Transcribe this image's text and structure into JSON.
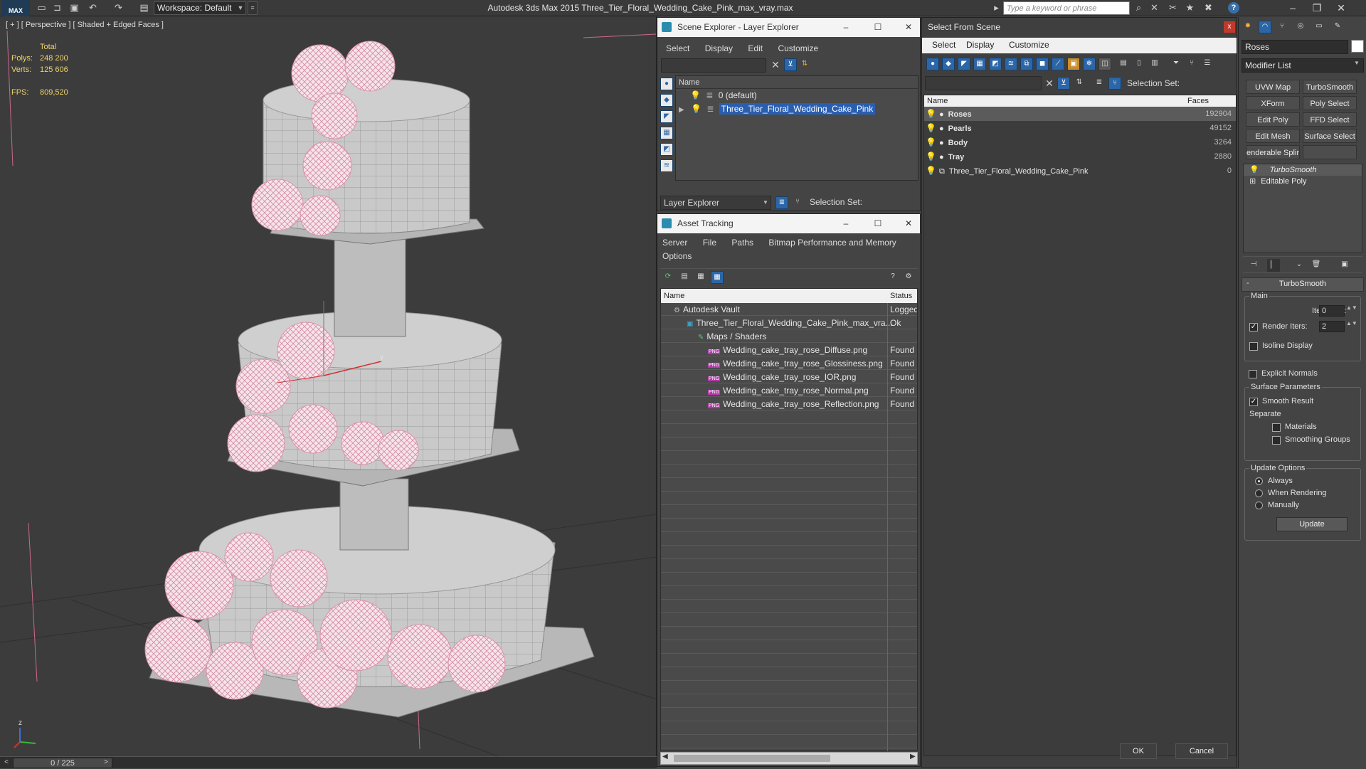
{
  "titlebar": {
    "logo": "MAX",
    "workspace": "Workspace: Default",
    "title": "Autodesk 3ds Max  2015     Three_Tier_Floral_Wedding_Cake_Pink_max_vray.max",
    "search_placeholder": "Type a keyword or phrase"
  },
  "viewport": {
    "label": "[ + ] [ Perspective ] [ Shaded + Edged Faces ]",
    "stats": {
      "total_label": "Total",
      "polys_label": "Polys:",
      "polys_value": "248 200",
      "verts_label": "Verts:",
      "verts_value": "125 606",
      "fps_label": "FPS:",
      "fps_value": "809,520"
    },
    "axis": {
      "x": "x",
      "y": "y",
      "z": "z"
    }
  },
  "timeline": {
    "counter": "0 / 225",
    "prev": "<",
    "next": ">"
  },
  "scene_explorer": {
    "title": "Scene Explorer - Layer Explorer",
    "menu": [
      "Select",
      "Display",
      "Edit",
      "Customize"
    ],
    "col_name": "Name",
    "layers": [
      {
        "name": "0 (default)",
        "selected": false
      },
      {
        "name": "Three_Tier_Floral_Wedding_Cake_Pink",
        "selected": true
      }
    ],
    "footer_dropdown": "Layer Explorer",
    "selection_set_label": "Selection Set:"
  },
  "asset_tracking": {
    "title": "Asset Tracking",
    "menu": [
      "Server",
      "File",
      "Paths",
      "Bitmap Performance and Memory"
    ],
    "menu2": [
      "Options"
    ],
    "col_name": "Name",
    "col_status": "Status",
    "rows": [
      {
        "name": "Autodesk Vault",
        "status": "Logged",
        "indent": 1
      },
      {
        "name": "Three_Tier_Floral_Wedding_Cake_Pink_max_vra...",
        "status": "Ok",
        "indent": 2
      },
      {
        "name": "Maps / Shaders",
        "status": "",
        "indent": 3
      },
      {
        "name": "Wedding_cake_tray_rose_Diffuse.png",
        "status": "Found",
        "indent": 4
      },
      {
        "name": "Wedding_cake_tray_rose_Glossiness.png",
        "status": "Found",
        "indent": 4
      },
      {
        "name": "Wedding_cake_tray_rose_IOR.png",
        "status": "Found",
        "indent": 4
      },
      {
        "name": "Wedding_cake_tray_rose_Normal.png",
        "status": "Found",
        "indent": 4
      },
      {
        "name": "Wedding_cake_tray_rose_Reflection.png",
        "status": "Found",
        "indent": 4
      }
    ]
  },
  "select_from_scene": {
    "title": "Select From Scene",
    "close": "x",
    "menu": [
      "Select",
      "Display",
      "Customize"
    ],
    "selection_set_label": "Selection Set:",
    "col_name": "Name",
    "col_faces": "Faces",
    "objects": [
      {
        "name": "Roses",
        "faces": "192904",
        "selected": true,
        "bold": true
      },
      {
        "name": "Pearls",
        "faces": "49152",
        "selected": false,
        "bold": true
      },
      {
        "name": "Body",
        "faces": "3264",
        "selected": false,
        "bold": true
      },
      {
        "name": "Tray",
        "faces": "2880",
        "selected": false,
        "bold": true
      },
      {
        "name": "Three_Tier_Floral_Wedding_Cake_Pink",
        "faces": "0",
        "selected": false,
        "bold": false
      }
    ],
    "ok": "OK",
    "cancel": "Cancel"
  },
  "command_panel": {
    "object_name": "Roses",
    "modifier_list": "Modifier List",
    "buttons": [
      "UVW Map",
      "TurboSmooth",
      "XForm",
      "Poly Select",
      "Edit Poly",
      "FFD Select",
      "Edit Mesh",
      "Surface Select",
      "enderable Splir",
      ""
    ],
    "stack": [
      {
        "name": "TurboSmooth",
        "italic": true
      },
      {
        "name": "Editable Poly",
        "italic": false
      }
    ],
    "rollout": {
      "title": "TurboSmooth",
      "collapse": "-",
      "main_label": "Main",
      "iterations_label": "Iterations:",
      "iterations_value": "0",
      "render_iters_label": "Render Iters:",
      "render_iters_value": "2",
      "isoline": "Isoline Display",
      "explicit": "Explicit Normals",
      "surface_label": "Surface Parameters",
      "smooth_result": "Smooth Result",
      "separate_label": "Separate",
      "materials": "Materials",
      "smoothing_groups": "Smoothing Groups",
      "update_label": "Update Options",
      "always": "Always",
      "when_rendering": "When Rendering",
      "manually": "Manually",
      "update_btn": "Update"
    }
  },
  "colors": {
    "selection_blue": "#2a5fb0",
    "stat_yellow": "#f0d36a",
    "panel_gray": "#444444"
  }
}
